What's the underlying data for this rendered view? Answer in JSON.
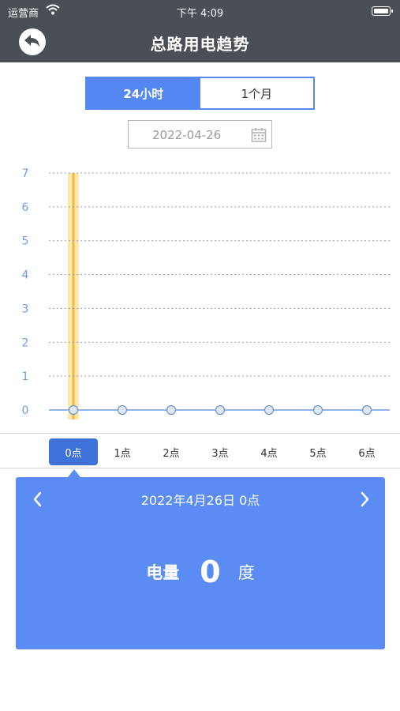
{
  "status_bar": {
    "carrier": "运营商",
    "time": "下午 4:09"
  },
  "nav": {
    "title": "总路用电趋势",
    "back_icon": "back-arrow-icon"
  },
  "tabs": [
    {
      "label": "24小时",
      "active": true
    },
    {
      "label": "1个月",
      "active": false
    }
  ],
  "date_picker": {
    "value": "2022-04-26",
    "icon": "calendar-icon"
  },
  "chart_data": {
    "type": "line",
    "x": [
      "0点",
      "1点",
      "2点",
      "3点",
      "4点",
      "5点",
      "6点"
    ],
    "series": [
      {
        "values": [
          0,
          0,
          0,
          0,
          0,
          0,
          0
        ]
      }
    ],
    "y_ticks": [
      "0",
      "1",
      "2",
      "3",
      "4",
      "5",
      "6",
      "7"
    ],
    "ylim": [
      0,
      7
    ],
    "grid": true,
    "selected_index": 0
  },
  "detail": {
    "title": "2022年4月26日 0点",
    "metric_label": "电量",
    "metric_value": "0",
    "metric_unit": "度",
    "prev_icon": "chevron-left-icon",
    "next_icon": "chevron-right-icon"
  },
  "colors": {
    "accent": "#5588f2",
    "panel": "#5b8cf3",
    "line": "#6f9ae6",
    "highlight": "#f5d66b",
    "nav": "#4a4e55"
  }
}
